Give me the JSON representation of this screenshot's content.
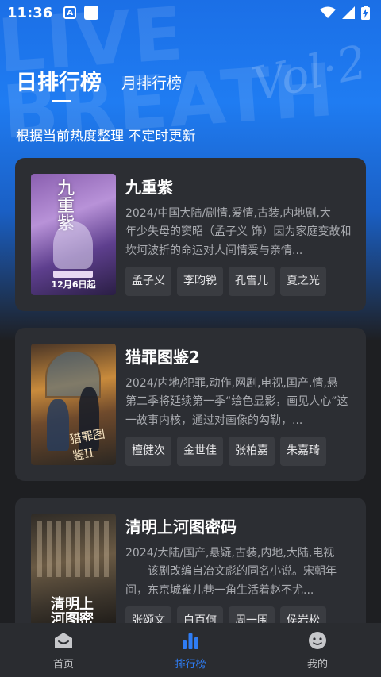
{
  "status_bar": {
    "time": "11:36",
    "badge_letter": "A",
    "icons": [
      "wifi-icon",
      "signal-icon",
      "battery-charging-icon"
    ]
  },
  "hero": {
    "deco_text": "LIVE BREATH",
    "deco_script": "Vol·2"
  },
  "tabs": {
    "daily": "日排行榜",
    "monthly": "月排行榜",
    "active": "daily"
  },
  "subtitle": "根据当前热度整理 不定时更新",
  "items": [
    {
      "title": "九重紫",
      "meta": "2024/中国大陆/剧情,爱情,古装,内地剧,大",
      "desc": "年少失母的窦昭（孟子义 饰）因为家庭变故和坎坷波折的命运对人间情爱与亲情...",
      "tags": [
        "孟子义",
        "李昀锐",
        "孔雪儿",
        "夏之光"
      ],
      "poster_title": "九重紫",
      "poster_date": "12月6日起"
    },
    {
      "title": "猎罪图鉴2",
      "meta": "2024/内地/犯罪,动作,网剧,电视,国产,情,悬",
      "desc": "第二季将延续第一季“绘色显影，画见人心”这一故事内核，通过对画像的勾勒，...",
      "tags": [
        "檀健次",
        "金世佳",
        "张柏嘉",
        "朱嘉琦"
      ],
      "poster_title": "猎罪图鉴II"
    },
    {
      "title": "清明上河图密码",
      "meta": "2024/大陆/国产,悬疑,古装,内地,大陆,电视",
      "desc": "　　该剧改编自冶文彪的同名小说。宋朝年间，东京城雀儿巷一角生活着赵不尤...",
      "tags": [
        "张颂文",
        "白百何",
        "周一围",
        "侯岩松"
      ],
      "poster_title": "清明上河图密码"
    }
  ],
  "bottom_nav": [
    {
      "label": "首页",
      "icon": "home-icon",
      "active": false
    },
    {
      "label": "排行榜",
      "icon": "ranking-chart-icon",
      "active": true
    },
    {
      "label": "我的",
      "icon": "profile-face-icon",
      "active": false
    }
  ],
  "colors": {
    "accent": "#2f7df4",
    "card_bg": "#2c2e33",
    "page_bg": "#1e1f22",
    "hero_blue": "#1f7cf2"
  }
}
